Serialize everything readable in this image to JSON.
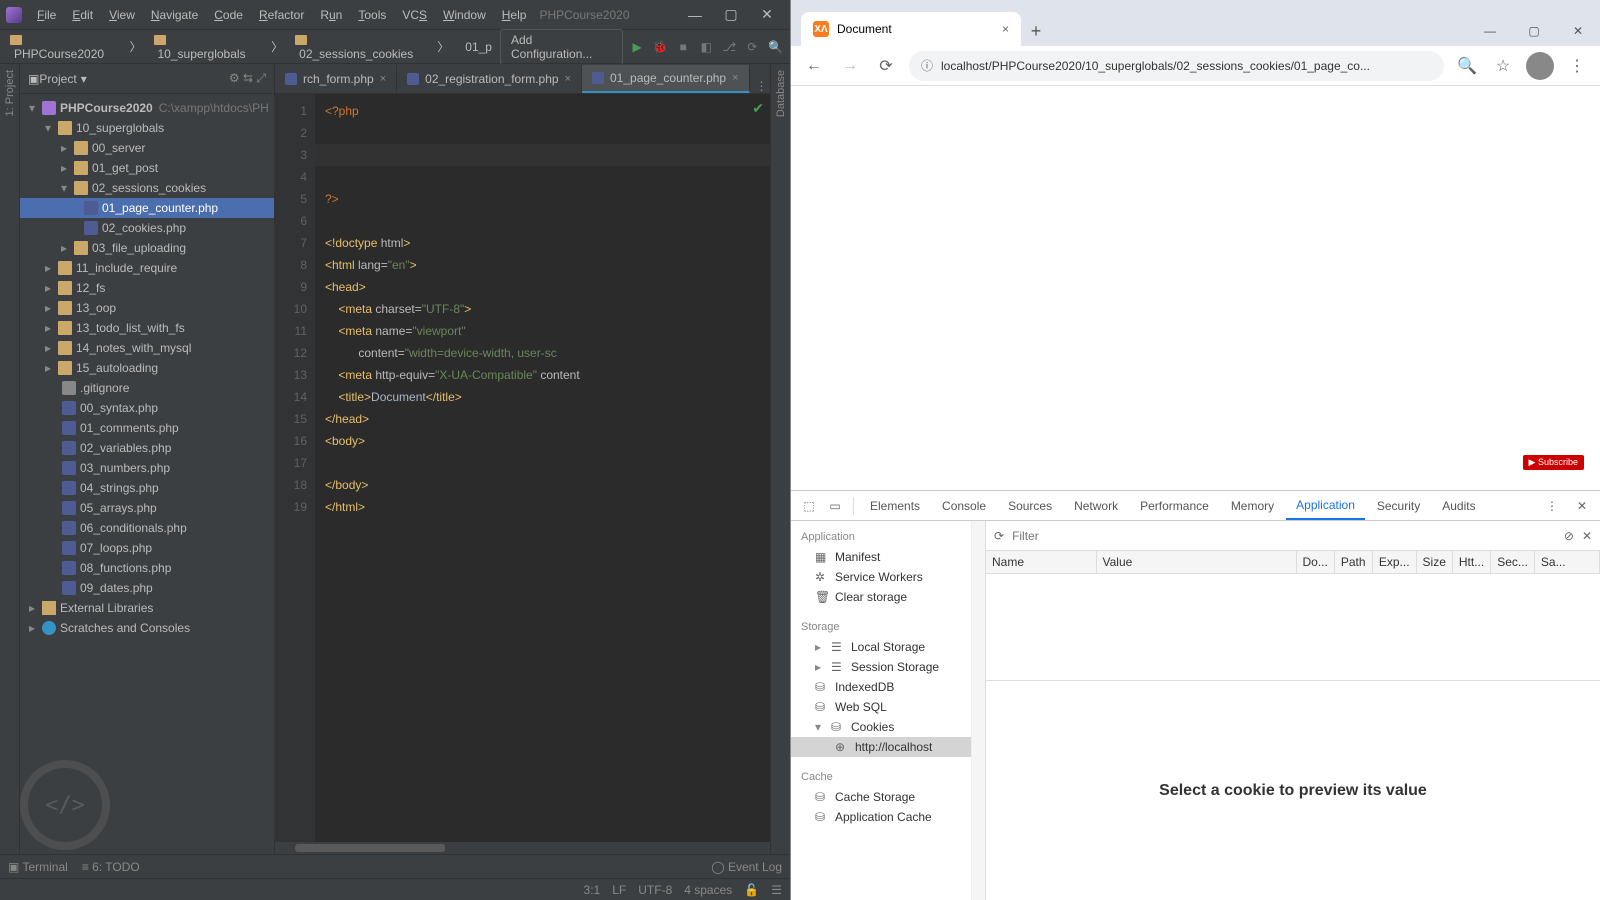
{
  "ide": {
    "menu": [
      "File",
      "Edit",
      "View",
      "Navigate",
      "Code",
      "Refactor",
      "Run",
      "Tools",
      "VCS",
      "Window",
      "Help"
    ],
    "title_project": "PHPCourse2020",
    "breadcrumb": [
      "PHPCourse2020",
      "10_superglobals",
      "02_sessions_cookies",
      "01_p"
    ],
    "add_config": "Add Configuration...",
    "project_label": "Project",
    "left_tool": "1: Project",
    "right_tool": "Database",
    "tree_root": "PHPCourse2020",
    "tree_root_path": "C:\\xampp\\htdocs\\PH",
    "tree": {
      "d10": "10_superglobals",
      "d10_0": "00_server",
      "d10_1": "01_get_post",
      "d10_2": "02_sessions_cookies",
      "d10_2_f1": "01_page_counter.php",
      "d10_2_f2": "02_cookies.php",
      "d10_3": "03_file_uploading",
      "d11": "11_include_require",
      "d12": "12_fs",
      "d13": "13_oop",
      "d13b": "13_todo_list_with_fs",
      "d14": "14_notes_with_mysql",
      "d15": "15_autoloading",
      "gi": ".gitignore",
      "f00": "00_syntax.php",
      "f01": "01_comments.php",
      "f02": "02_variables.php",
      "f03": "03_numbers.php",
      "f04": "04_strings.php",
      "f05": "05_arrays.php",
      "f06": "06_conditionals.php",
      "f07": "07_loops.php",
      "f08": "08_functions.php",
      "f09": "09_dates.php",
      "ext": "External Libraries",
      "scr": "Scratches and Consoles"
    },
    "tabs": {
      "t1": "rch_form.php",
      "t2": "02_registration_form.php",
      "t3": "01_page_counter.php"
    },
    "bottom": {
      "terminal": "Terminal",
      "todo": "6: TODO",
      "eventlog": "Event Log"
    },
    "status": {
      "pos": "3:1",
      "le": "LF",
      "enc": "UTF-8",
      "ind": "4 spaces"
    }
  },
  "browser": {
    "tab_title": "Document",
    "url": "localhost/PHPCourse2020/10_superglobals/02_sessions_cookies/01_page_co...",
    "yt": "▶ Subscribe"
  },
  "devtools": {
    "tabs": [
      "Elements",
      "Console",
      "Sources",
      "Network",
      "Performance",
      "Memory",
      "Application",
      "Security",
      "Audits"
    ],
    "active": "Application",
    "filter_ph": "Filter",
    "side": {
      "sec_app": "Application",
      "manifest": "Manifest",
      "sw": "Service Workers",
      "clear": "Clear storage",
      "sec_stor": "Storage",
      "ls": "Local Storage",
      "ss": "Session Storage",
      "idb": "IndexedDB",
      "wsql": "Web SQL",
      "ck": "Cookies",
      "ck_host": "http://localhost",
      "sec_cache": "Cache",
      "cs": "Cache Storage",
      "ac": "Application Cache"
    },
    "cols": [
      "Name",
      "Value",
      "Do...",
      "Path",
      "Exp...",
      "Size",
      "Htt...",
      "Sec...",
      "Sa..."
    ],
    "preview": "Select a cookie to preview its value"
  }
}
